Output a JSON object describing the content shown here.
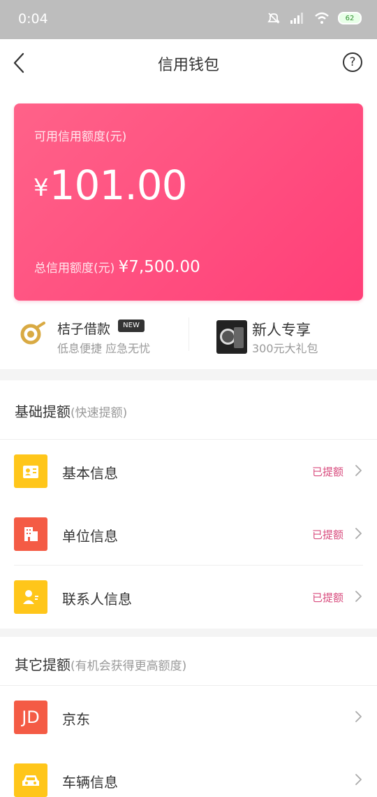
{
  "status_bar": {
    "time": "0:04",
    "battery": "62"
  },
  "header": {
    "title": "信用钱包"
  },
  "credit_card": {
    "label": "可用信用额度(元)",
    "currency": "¥",
    "amount": "101.00",
    "total_label": "总信用额度(元)",
    "total_value": "¥7,500.00"
  },
  "promos": {
    "loan": {
      "title": "桔子借款",
      "badge": "NEW",
      "subtitle": "低息便捷  应急无忧"
    },
    "gift": {
      "title": "新人专享",
      "subtitle": "300元大礼包"
    }
  },
  "basic_section": {
    "title": "基础提额",
    "subtitle": "(快速提额)",
    "items": [
      {
        "label": "基本信息",
        "status": "已提额"
      },
      {
        "label": "单位信息",
        "status": "已提额"
      },
      {
        "label": "联系人信息",
        "status": "已提额"
      }
    ]
  },
  "other_section": {
    "title": "其它提额",
    "subtitle": "(有机会获得更高额度)",
    "items": [
      {
        "label": "京东",
        "icon_text": "JD"
      },
      {
        "label": "车辆信息"
      }
    ]
  },
  "colors": {
    "card_start": "#ff6289",
    "card_end": "#ff3f78",
    "status_text": "#d84b7d",
    "yellow_icon": "#ffc61a",
    "red_icon": "#f45b45"
  },
  "icons": {
    "back": "chevron-left-icon",
    "help": "question-circle-icon",
    "loan": "orange-coin-icon",
    "basic_info": "id-card-icon",
    "company_info": "building-icon",
    "contacts": "person-icon",
    "vehicle": "car-icon"
  }
}
